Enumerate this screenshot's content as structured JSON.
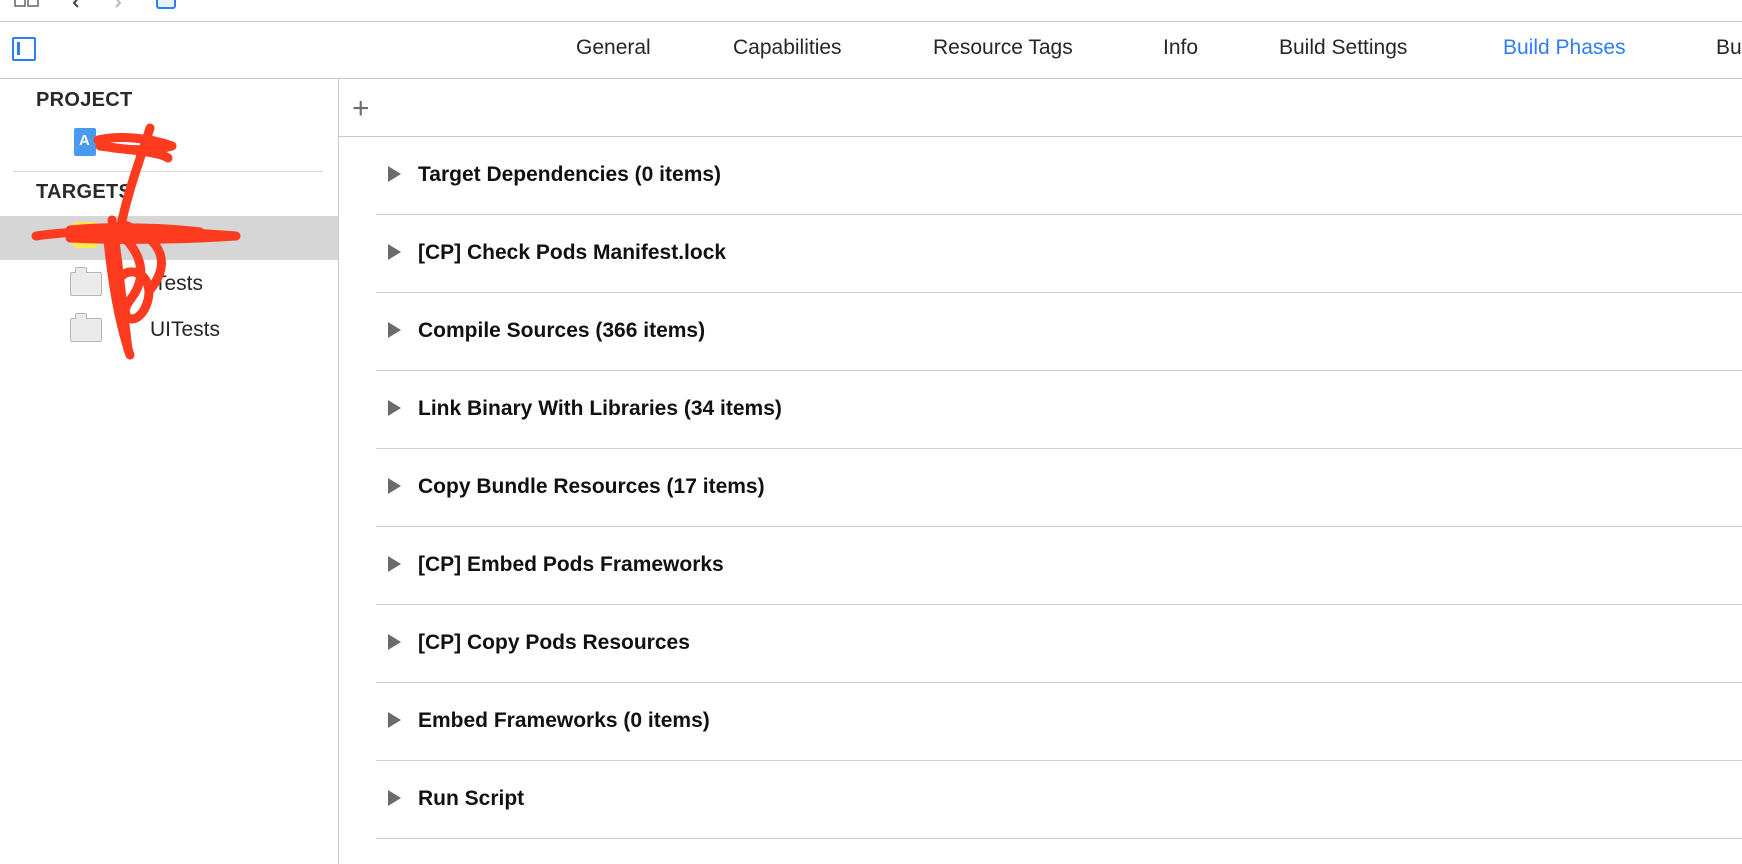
{
  "tabs": [
    {
      "label": "General",
      "active": false
    },
    {
      "label": "Capabilities",
      "active": false
    },
    {
      "label": "Resource Tags",
      "active": false
    },
    {
      "label": "Info",
      "active": false
    },
    {
      "label": "Build Settings",
      "active": false
    },
    {
      "label": "Build Phases",
      "active": true
    },
    {
      "label": "Bu",
      "active": false
    }
  ],
  "sidebar": {
    "project_header": "PROJECT",
    "targets_header": "TARGETS",
    "targets": [
      {
        "label": "Tests"
      },
      {
        "label": "UITests"
      }
    ]
  },
  "main": {
    "add_label": "+",
    "phases": [
      {
        "label": "Target Dependencies (0 items)"
      },
      {
        "label": "[CP] Check Pods Manifest.lock"
      },
      {
        "label": "Compile Sources (366 items)"
      },
      {
        "label": "Link Binary With Libraries (34 items)"
      },
      {
        "label": "Copy Bundle Resources (17 items)"
      },
      {
        "label": "[CP] Embed Pods Frameworks"
      },
      {
        "label": "[CP] Copy Pods Resources"
      },
      {
        "label": "Embed Frameworks (0 items)"
      },
      {
        "label": "Run Script"
      }
    ]
  },
  "colors": {
    "accent": "#2d7df6",
    "selection": "#d6d6d6",
    "redaction": "#ff3b1f"
  }
}
